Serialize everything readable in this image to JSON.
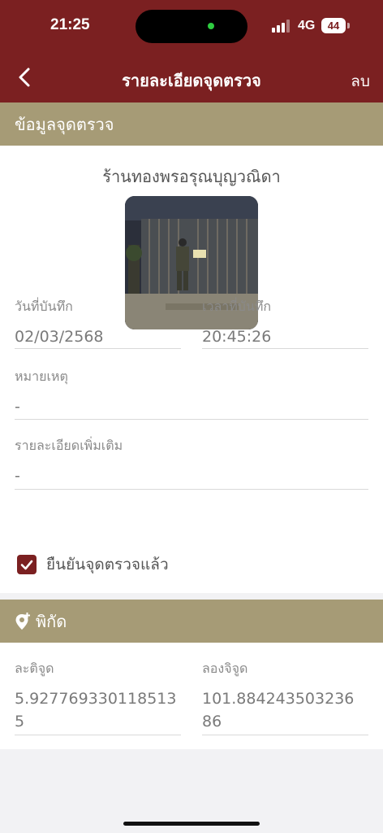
{
  "status_bar": {
    "time": "21:25",
    "network": "4G",
    "battery": "44"
  },
  "header": {
    "title": "รายละเอียดจุดตรวจ",
    "delete_label": "ลบ"
  },
  "section_info": {
    "title": "ข้อมูลจุดตรวจ"
  },
  "checkpoint": {
    "shop_name": "ร้านทองพรอรุณบุญวณิดา",
    "date_label": "วันที่บันทึก",
    "date_value": "02/03/2568",
    "time_label": "เวลาที่บันทึก",
    "time_value": "20:45:26",
    "note_label": "หมายเหตุ",
    "note_value": "-",
    "details_label": "รายละเอียดเพิ่มเติม",
    "details_value": "-",
    "confirmed_label": "ยืนยันจุดตรวจแล้ว",
    "confirmed": true
  },
  "section_coords": {
    "title": "พิกัด",
    "icon": "map-pin-plus-icon"
  },
  "coords": {
    "lat_label": "ละติจูด",
    "lat_value": "5.927769330118513 5",
    "lng_label": "ลองจิจูด",
    "lng_value": "101.884243503236 86"
  },
  "colors": {
    "primary": "#7b2021",
    "section": "#a69b76"
  }
}
